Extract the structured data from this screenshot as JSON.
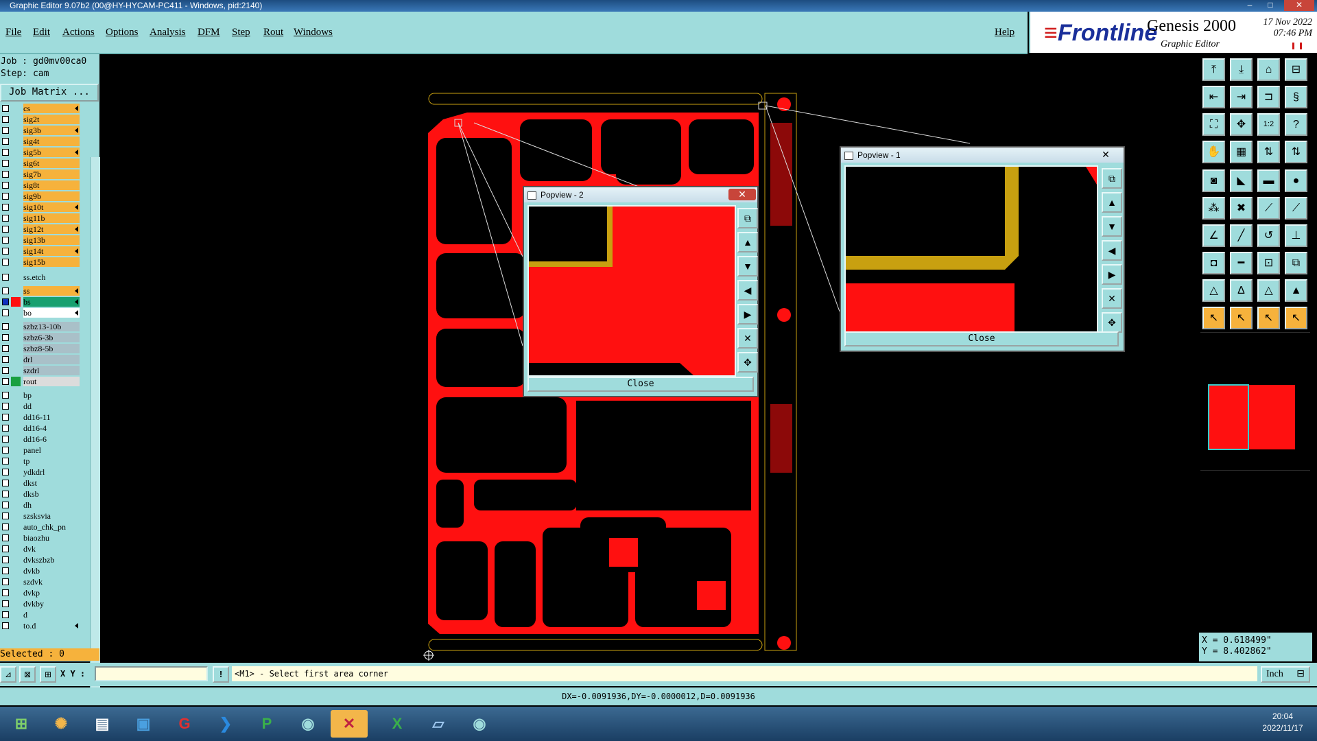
{
  "window": {
    "title": "Graphic Editor 9.07b2 (00@HY-HYCAM-PC411 - Windows, pid:2140)",
    "minimize_glyph": "–",
    "maximize_glyph": "□",
    "close_glyph": "✕"
  },
  "menu": {
    "items": [
      "File",
      "Edit",
      "Actions",
      "Options",
      "Analysis",
      "DFM",
      "Step",
      "Rout",
      "Windows"
    ],
    "help": "Help"
  },
  "branding": {
    "logo": "Frontline",
    "product": "Genesis 2000",
    "subtitle": "Graphic Editor",
    "date": "17 Nov 2022",
    "time": "07:46 PM"
  },
  "left_panel": {
    "job": "Job : gd0mv00ca0",
    "step": "Step: cam",
    "job_matrix": "Job Matrix ...",
    "selected": "Selected : 0",
    "layers": [
      {
        "name": "cs",
        "color": "#f6b23c",
        "arrow": true
      },
      {
        "name": "sig2t",
        "color": "#f6b23c",
        "arrow": false
      },
      {
        "name": "sig3b",
        "color": "#f6b23c",
        "arrow": true
      },
      {
        "name": "sig4t",
        "color": "#f6b23c",
        "arrow": false
      },
      {
        "name": "sig5b",
        "color": "#f6b23c",
        "arrow": true
      },
      {
        "name": "sig6t",
        "color": "#f6b23c",
        "arrow": false
      },
      {
        "name": "sig7b",
        "color": "#f6b23c",
        "arrow": false
      },
      {
        "name": "sig8t",
        "color": "#f6b23c",
        "arrow": false
      },
      {
        "name": "sig9b",
        "color": "#f6b23c",
        "arrow": false
      },
      {
        "name": "sig10t",
        "color": "#f6b23c",
        "arrow": true
      },
      {
        "name": "sig11b",
        "color": "#f6b23c",
        "arrow": false
      },
      {
        "name": "sig12t",
        "color": "#f6b23c",
        "arrow": true
      },
      {
        "name": "sig13b",
        "color": "#f6b23c",
        "arrow": false
      },
      {
        "name": "sig14t",
        "color": "#f6b23c",
        "arrow": true
      },
      {
        "name": "sig15b",
        "color": "#f6b23c",
        "arrow": false
      },
      {
        "name": "ss.etch",
        "color": "#9fdcdc",
        "arrow": false
      },
      {
        "name": "ss",
        "color": "#f6b23c",
        "arrow": true
      },
      {
        "name": "bs",
        "color": "#18a070",
        "arrow": true,
        "swatch": "#ff1010",
        "checked": true
      },
      {
        "name": "bo",
        "color": "#ffffff",
        "arrow": true
      },
      {
        "name": "szbz13-10b",
        "color": "#a9c0c8",
        "arrow": false
      },
      {
        "name": "szbz6-3b",
        "color": "#a9c0c8",
        "arrow": false
      },
      {
        "name": "szbz8-5b",
        "color": "#a9c0c8",
        "arrow": false
      },
      {
        "name": "drl",
        "color": "#a9c0c8",
        "arrow": false
      },
      {
        "name": "szdrl",
        "color": "#a9c0c8",
        "arrow": false
      },
      {
        "name": "rout",
        "color": "#dcdcdc",
        "arrow": false,
        "swatch": "#18a040"
      },
      {
        "name": "bp",
        "color": "#9fdcdc",
        "arrow": false
      },
      {
        "name": "dd",
        "color": "#9fdcdc",
        "arrow": false
      },
      {
        "name": "dd16-11",
        "color": "#9fdcdc",
        "arrow": false
      },
      {
        "name": "dd16-4",
        "color": "#9fdcdc",
        "arrow": false
      },
      {
        "name": "dd16-6",
        "color": "#9fdcdc",
        "arrow": false
      },
      {
        "name": "panel",
        "color": "#9fdcdc",
        "arrow": false
      },
      {
        "name": "tp",
        "color": "#9fdcdc",
        "arrow": false
      },
      {
        "name": "ydkdrl",
        "color": "#9fdcdc",
        "arrow": false
      },
      {
        "name": "dkst",
        "color": "#9fdcdc",
        "arrow": false
      },
      {
        "name": "dksb",
        "color": "#9fdcdc",
        "arrow": false
      },
      {
        "name": "dh",
        "color": "#9fdcdc",
        "arrow": false
      },
      {
        "name": "szsksvia",
        "color": "#9fdcdc",
        "arrow": false
      },
      {
        "name": "auto_chk_pn",
        "color": "#9fdcdc",
        "arrow": false
      },
      {
        "name": "biaozhu",
        "color": "#9fdcdc",
        "arrow": false
      },
      {
        "name": "dvk",
        "color": "#9fdcdc",
        "arrow": false
      },
      {
        "name": "dvkszbzb",
        "color": "#9fdcdc",
        "arrow": false
      },
      {
        "name": "dvkb",
        "color": "#9fdcdc",
        "arrow": false
      },
      {
        "name": "szdvk",
        "color": "#9fdcdc",
        "arrow": false
      },
      {
        "name": "dvkp",
        "color": "#9fdcdc",
        "arrow": false
      },
      {
        "name": "dvkby",
        "color": "#9fdcdc",
        "arrow": false
      },
      {
        "name": "d",
        "color": "#9fdcdc",
        "arrow": false
      },
      {
        "name": "to.d",
        "color": "#9fdcdc",
        "arrow": true
      }
    ]
  },
  "popview1": {
    "title": "Popview - 1",
    "close_label": "Close",
    "close_glyph": "✕"
  },
  "popview2": {
    "title": "Popview - 2",
    "close_label": "Close",
    "close_glyph": "✕"
  },
  "coords": {
    "x": "X = 0.618499\"",
    "y": "Y = 8.402862\""
  },
  "statusbar": {
    "xy_label": "X Y :",
    "xy_value": "",
    "bang": "!",
    "prompt": "<M1> - Select first area corner",
    "units": "Inch",
    "measure": "DX=-0.0091936,DY=-0.0000012,D=0.0091936"
  },
  "taskbar": {
    "time": "20:04",
    "date": "2022/11/17"
  },
  "colors": {
    "panel": "#9fdcdc",
    "layer_active": "#f6b23c",
    "board_red": "#ff1010",
    "trace_gold": "#c8a010"
  }
}
